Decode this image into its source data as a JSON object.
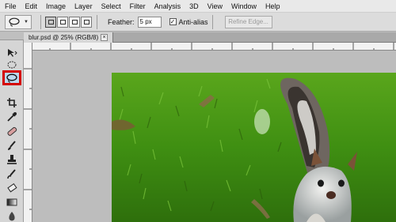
{
  "menu": [
    "File",
    "Edit",
    "Image",
    "Layer",
    "Select",
    "Filter",
    "Analysis",
    "3D",
    "View",
    "Window",
    "Help"
  ],
  "options": {
    "tool_icon": "lasso-icon",
    "selection_modes": [
      "new-selection",
      "add-to-selection",
      "subtract-from-selection",
      "intersect-selection"
    ],
    "feather_label": "Feather:",
    "feather_value": "5 px",
    "antialias_label": "Anti-alias",
    "antialias_checked": true,
    "refine_edge_label": "Refine Edge..."
  },
  "document": {
    "tab_title": "blur.psd @ 25% (RGB/8)",
    "close_symbol": "×"
  },
  "toolbar": {
    "active_tool": "lasso-tool",
    "highlight_color": "#d40000"
  },
  "photo": {
    "subject": "squirrel on grass"
  }
}
